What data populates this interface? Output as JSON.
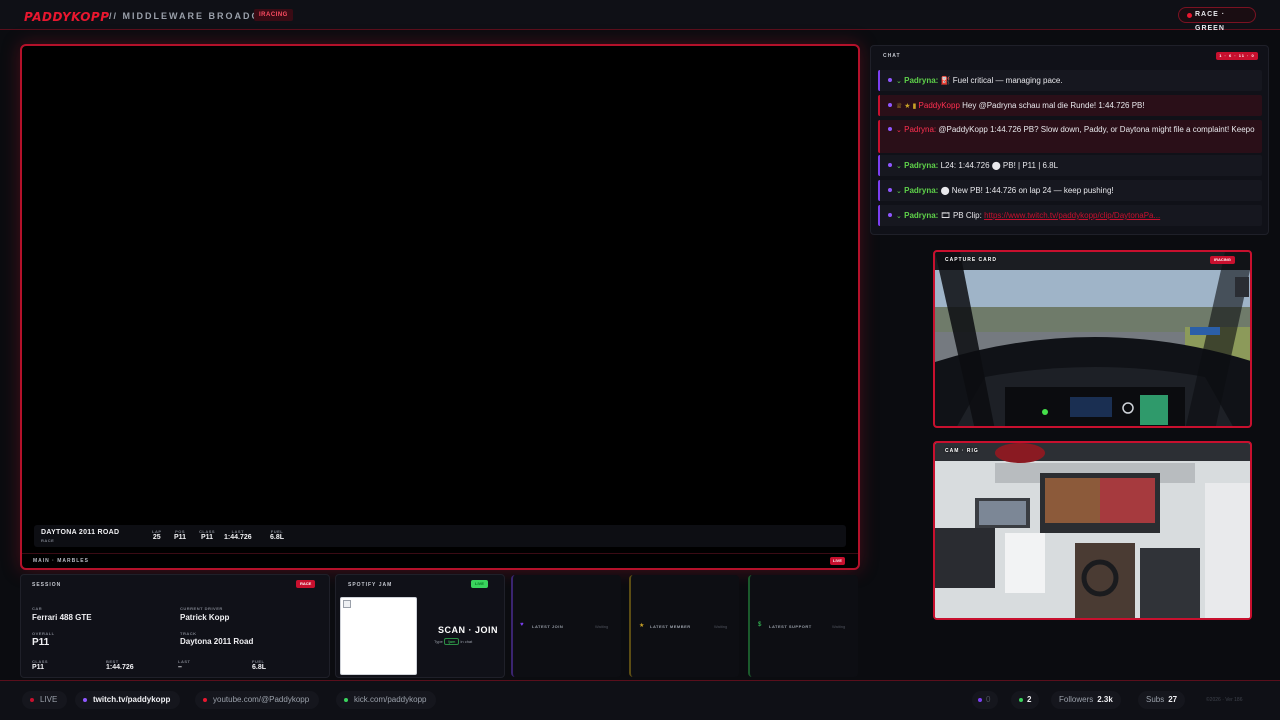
{
  "header": {
    "brand": "PADDYKOPP",
    "subtitle": "// MIDDLEWARE BROADCAST",
    "tag": "IRACING",
    "race_pill": "RACE · GREEN"
  },
  "main": {
    "track": "DAYTONA 2011 ROAD",
    "mode": "RACE",
    "telemetry": [
      {
        "label": "LAP",
        "value": "25"
      },
      {
        "label": "POS",
        "value": "P11"
      },
      {
        "label": "CLASS",
        "value": "P11"
      },
      {
        "label": "LAST",
        "value": "1:44.726"
      },
      {
        "label": "FUEL",
        "value": "6.8L"
      }
    ],
    "footer_label": "MAIN · MARBLES",
    "live_badge": "LIVE"
  },
  "chat": {
    "title": "CHAT",
    "counter": "1 · 6 · 11 · 0",
    "messages": [
      {
        "user": "Padryna:",
        "icons": "⌄",
        "text": "⛽ Fuel critical — managing pace."
      },
      {
        "user": "PaddyKopp",
        "icons": "♕ ★ ▮",
        "text": "Hey @Padryna schau mal die Runde! 1:44.726 PB!",
        "highlight": true
      },
      {
        "user": "Padryna:",
        "icons": "⌄",
        "text": "@PaddyKopp 1:44.726 PB? Slow down, Paddy, or Daytona might file a complaint! Keepo",
        "highlight": true
      },
      {
        "user": "Padryna:",
        "icons": "⌄",
        "text": "L24: 1:44.726 ⬤ PB! | P11 | 6.8L"
      },
      {
        "user": "Padryna:",
        "icons": "⌄",
        "text": "⬤ New PB! 1:44.726 on lap 24 — keep pushing!"
      },
      {
        "user": "Padryna:",
        "icons": "⌄",
        "text": "🎞 PB Clip: ",
        "link": "https://www.twitch.tv/paddykopp/clip/DaytonaPa..."
      }
    ]
  },
  "capture": {
    "label": "CAPTURE CARD",
    "badge": "IRACING"
  },
  "cam": {
    "label": "CAM · RIG"
  },
  "session": {
    "title": "SESSION",
    "badge": "RACE",
    "car_label": "CAR",
    "car": "Ferrari 488 GTE",
    "driver_label": "CURRENT DRIVER",
    "driver": "Patrick Kopp",
    "overall_label": "OVERALL",
    "overall": "P11",
    "track_label": "TRACK",
    "track": "Daytona 2011 Road",
    "class_label": "CLASS",
    "class": "P11",
    "best_label": "BEST",
    "best": "1:44.726",
    "last_label": "LAST",
    "last": "–",
    "fuel_label": "FUEL",
    "fuel": "6.8L"
  },
  "spotify": {
    "title": "SPOTIFY JAM",
    "badge": "LIVE",
    "scan_title": "SCAN · JOIN",
    "scan_sub_pre": "Type",
    "scan_sub_kw": "!jam",
    "scan_sub_post": "in chat"
  },
  "alerts": [
    {
      "label": "LATEST JOIN",
      "value": "Waiting",
      "icon": "♥",
      "color": "#7b3ff2"
    },
    {
      "label": "LATEST MEMBER",
      "value": "Waiting",
      "icon": "★",
      "color": "#c9a227"
    },
    {
      "label": "LATEST SUPPORT",
      "value": "Waiting",
      "icon": "$",
      "color": "#3ad45d"
    }
  ],
  "bottom": {
    "live": "LIVE",
    "twitch": "twitch.tv/paddykopp",
    "youtube": "youtube.com/@Paddykopp",
    "kick": "kick.com/paddykopp",
    "viewers_a": "0",
    "viewers_b": "2",
    "followers_label": "Followers",
    "followers": "2.3k",
    "subs_label": "Subs",
    "subs": "27",
    "copyright": "©2026 · Ver 186"
  }
}
